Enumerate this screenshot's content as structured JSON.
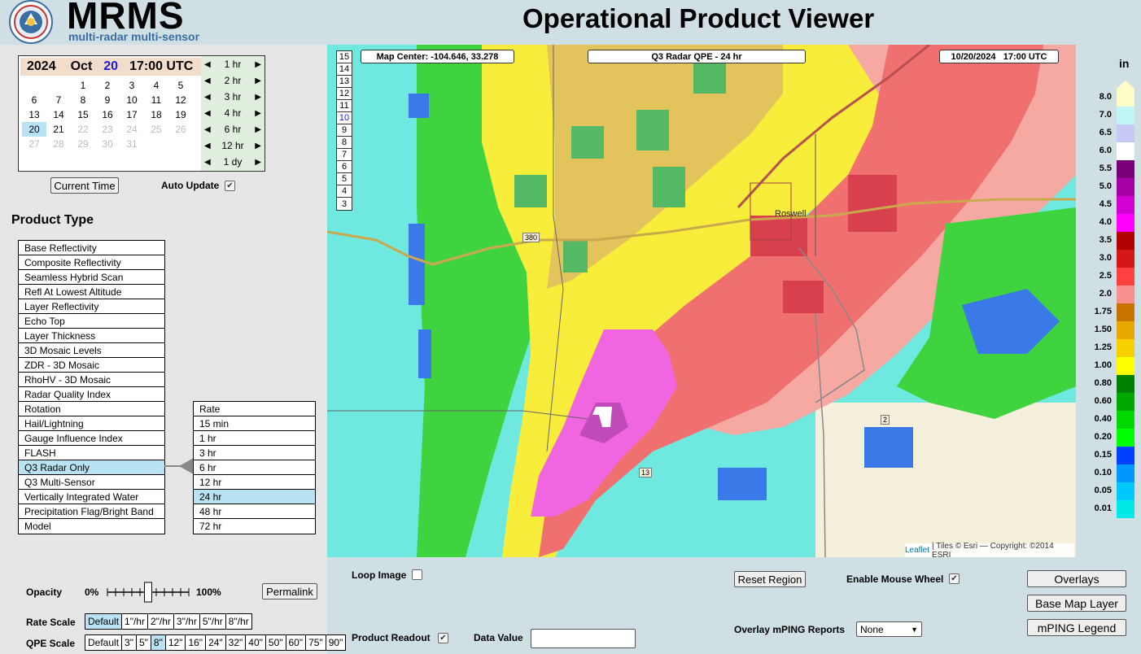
{
  "header": {
    "brand": "MRMS",
    "subtitle": "multi-radar multi-sensor",
    "title": "Operational Product Viewer",
    "logo_text": "NSSL"
  },
  "calendar": {
    "year": "2024",
    "month": "Oct",
    "day": "20",
    "time": "17:00 UTC",
    "days": [
      [
        "",
        "",
        "1",
        "2",
        "3",
        "4",
        "5"
      ],
      [
        "6",
        "7",
        "8",
        "9",
        "10",
        "11",
        "12"
      ],
      [
        "13",
        "14",
        "15",
        "16",
        "17",
        "18",
        "19"
      ],
      [
        "20",
        "21",
        "22",
        "23",
        "24",
        "25",
        "26"
      ],
      [
        "27",
        "28",
        "29",
        "30",
        "31",
        "",
        ""
      ]
    ],
    "steps": [
      "1 hr",
      "2 hr",
      "3 hr",
      "4 hr",
      "6 hr",
      "12 hr",
      "1 dy"
    ]
  },
  "controls": {
    "current_time": "Current Time",
    "auto_update": "Auto Update"
  },
  "product_type": {
    "heading": "Product Type",
    "items": [
      "Base Reflectivity",
      "Composite Reflectivity",
      "Seamless Hybrid Scan",
      "Refl At Lowest Altitude",
      "Layer Reflectivity",
      "Echo Top",
      "Layer Thickness",
      "3D Mosaic Levels",
      "ZDR - 3D Mosaic",
      "RhoHV - 3D Mosaic",
      "Radar Quality Index",
      "Rotation",
      "Hail/Lightning",
      "Gauge Influence Index",
      "FLASH",
      "Q3 Radar Only",
      "Q3 Multi-Sensor",
      "Vertically Integrated Water",
      "Precipitation Flag/Bright Band",
      "Model"
    ],
    "selected": "Q3 Radar Only",
    "sub_items": [
      "Rate",
      "15 min",
      "1 hr",
      "3 hr",
      "6 hr",
      "12 hr",
      "24 hr",
      "48 hr",
      "72 hr"
    ],
    "sub_selected": "24 hr"
  },
  "opacity": {
    "label": "Opacity",
    "min": "0%",
    "max": "100%",
    "value": 0.5,
    "permalink": "Permalink"
  },
  "rate_scale": {
    "label": "Rate Scale",
    "options": [
      "Default",
      "1\"/hr",
      "2\"/hr",
      "3\"/hr",
      "5\"/hr",
      "8\"/hr"
    ],
    "selected": "Default"
  },
  "qpe_scale": {
    "label": "QPE Scale",
    "options": [
      "Default",
      "3\"",
      "5\"",
      "8\"",
      "12\"",
      "16\"",
      "24\"",
      "32\"",
      "40\"",
      "50\"",
      "60\"",
      "75\"",
      "90\""
    ],
    "selected": "8\""
  },
  "map": {
    "center": "Map Center: -104.646, 33.278",
    "product": "Q3 Radar QPE - 24 hr",
    "datetime": "10/20/2024   17:00 UTC",
    "zoom_levels": [
      "15",
      "14",
      "13",
      "12",
      "11",
      "10",
      "9",
      "8",
      "7",
      "6",
      "5",
      "4",
      "3"
    ],
    "zoom_selected": "10",
    "city": "Roswell",
    "routes": [
      "380",
      "13",
      "2"
    ],
    "attribution_link": "Leaflet",
    "attribution_text": "| Tiles © Esri — Copyright: ©2014 ESRI"
  },
  "legend": {
    "unit": "in",
    "entries": [
      {
        "label": "8.0",
        "color": "#fdfdc8"
      },
      {
        "label": "7.0",
        "color": "#c0f4f6"
      },
      {
        "label": "6.5",
        "color": "#c8c8f4"
      },
      {
        "label": "6.0",
        "color": "#ffffff"
      },
      {
        "label": "5.5",
        "color": "#7a007a"
      },
      {
        "label": "5.0",
        "color": "#a400a4"
      },
      {
        "label": "4.5",
        "color": "#d200d2"
      },
      {
        "label": "4.0",
        "color": "#ff00ff"
      },
      {
        "label": "3.5",
        "color": "#b00000"
      },
      {
        "label": "3.0",
        "color": "#d41818"
      },
      {
        "label": "2.5",
        "color": "#ff4040"
      },
      {
        "label": "2.0",
        "color": "#f89090"
      },
      {
        "label": "1.75",
        "color": "#c87400"
      },
      {
        "label": "1.50",
        "color": "#e8a800"
      },
      {
        "label": "1.25",
        "color": "#f8d000"
      },
      {
        "label": "1.00",
        "color": "#ffff00"
      },
      {
        "label": "0.80",
        "color": "#008000"
      },
      {
        "label": "0.60",
        "color": "#00a800"
      },
      {
        "label": "0.40",
        "color": "#00d800"
      },
      {
        "label": "0.20",
        "color": "#00ff00"
      },
      {
        "label": "0.15",
        "color": "#0040ff"
      },
      {
        "label": "0.10",
        "color": "#0098ff"
      },
      {
        "label": "0.05",
        "color": "#00c8ff"
      },
      {
        "label": "0.01",
        "color": "#00e8e8"
      }
    ]
  },
  "bottom": {
    "loop_image": "Loop Image",
    "reset_region": "Reset Region",
    "enable_mouse_wheel": "Enable Mouse Wheel",
    "overlays": "Overlays",
    "base_map_layer": "Base Map Layer",
    "mping_legend": "mPING Legend",
    "product_readout": "Product Readout",
    "data_value": "Data Value",
    "overlay_mping": "Overlay mPING Reports",
    "mping_value": "None"
  }
}
